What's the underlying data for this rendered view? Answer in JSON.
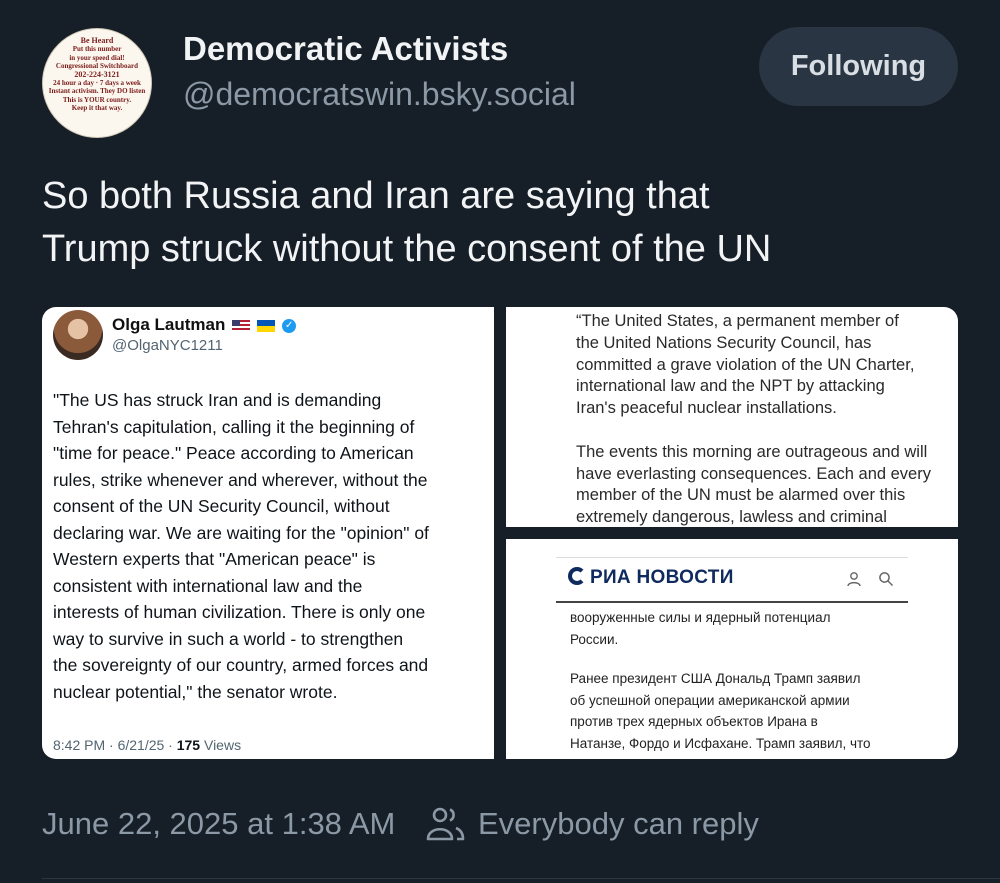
{
  "author": {
    "name": "Democratic Activists",
    "handle": "@democratswin.bsky.social",
    "avatar_lines": [
      "Be Heard",
      "Put this number",
      "in your speed dial!",
      "Congressional Switchboard",
      "202-224-3121",
      "24 hour a day · 7 days a week",
      "Instant activism. They DO listen",
      "This is YOUR country.",
      "Keep it that way."
    ]
  },
  "follow_button": {
    "label": "Following"
  },
  "post": {
    "lines": [
      "So both Russia and Iran are saying that",
      "Trump struck without the consent of the UN"
    ]
  },
  "embed_tweet": {
    "name": "Olga Lautman",
    "handle": "@OlgaNYC1211",
    "body_lines": [
      "\"The US has struck Iran and is demanding",
      "Tehran's capitulation, calling it the beginning of",
      "\"time for peace.\" Peace according to American",
      "rules, strike whenever and wherever, without the",
      "consent of the UN Security Council, without",
      "declaring war. We are waiting for the \"opinion\" of",
      "Western experts that \"American peace\" is",
      "consistent with international law and the",
      "interests of human civilization. There is only one",
      "way to survive in such a world - to strengthen",
      "the sovereignty of our country, armed forces and",
      "nuclear potential,\" the senator wrote."
    ],
    "time": "8:42 PM · 6/21/25 · ",
    "views_count": "175",
    "views_label": " Views"
  },
  "un_statement": {
    "para1": [
      "“The United States, a permanent member of",
      "the United Nations Security Council, has",
      "committed a grave violation of the UN Charter,",
      "international law and the NPT by attacking",
      "Iran's peaceful nuclear installations."
    ],
    "para2": [
      "The events this morning are outrageous and will",
      "have everlasting consequences. Each and every",
      "member of the UN must be alarmed over this",
      "extremely dangerous, lawless and criminal"
    ]
  },
  "ria": {
    "logo": "РИА НОВОСТИ",
    "para1": [
      "вооруженные силы и ядерный потенциал",
      "России."
    ],
    "para2": [
      "Ранее президент США Дональд Трамп заявил",
      "об успешной операции американской армии",
      "против трех ядерных объектов Ирана в",
      "Натанзе, Фордо и Исфахане. Трамп заявил, что"
    ]
  },
  "footer": {
    "timestamp": "June 22, 2025 at 1:38 AM",
    "reply_setting": "Everybody can reply"
  }
}
